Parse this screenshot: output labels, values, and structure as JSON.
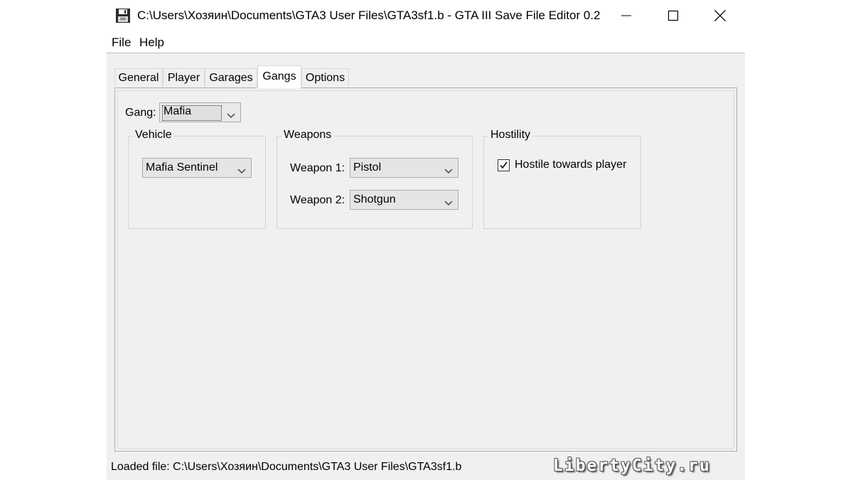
{
  "window": {
    "title": "C:\\Users\\Хозяин\\Documents\\GTA3 User Files\\GTA3sf1.b - GTA III Save File Editor 0.2",
    "app_icon": "floppy-disk-icon",
    "controls": [
      "minimize-icon",
      "maximize-icon",
      "close-icon"
    ]
  },
  "menu": {
    "items": [
      "File",
      "Help"
    ]
  },
  "tabs": {
    "items": [
      "General",
      "Player",
      "Garages",
      "Gangs",
      "Options"
    ],
    "active": "Gangs"
  },
  "gangs": {
    "gang_label": "Gang:",
    "gang_value": "Mafia",
    "vehicle": {
      "title": "Vehicle",
      "value": "Mafia Sentinel"
    },
    "weapons": {
      "title": "Weapons",
      "weapon1_label": "Weapon 1:",
      "weapon1_value": "Pistol",
      "weapon2_label": "Weapon 2:",
      "weapon2_value": "Shotgun"
    },
    "hostility": {
      "title": "Hostility",
      "checkbox_label": "Hostile towards player",
      "checked": true
    }
  },
  "status": {
    "text": "Loaded file: C:\\Users\\Хозяин\\Documents\\GTA3 User Files\\GTA3sf1.b"
  },
  "watermark": {
    "text": "LibertyCity.ru"
  }
}
